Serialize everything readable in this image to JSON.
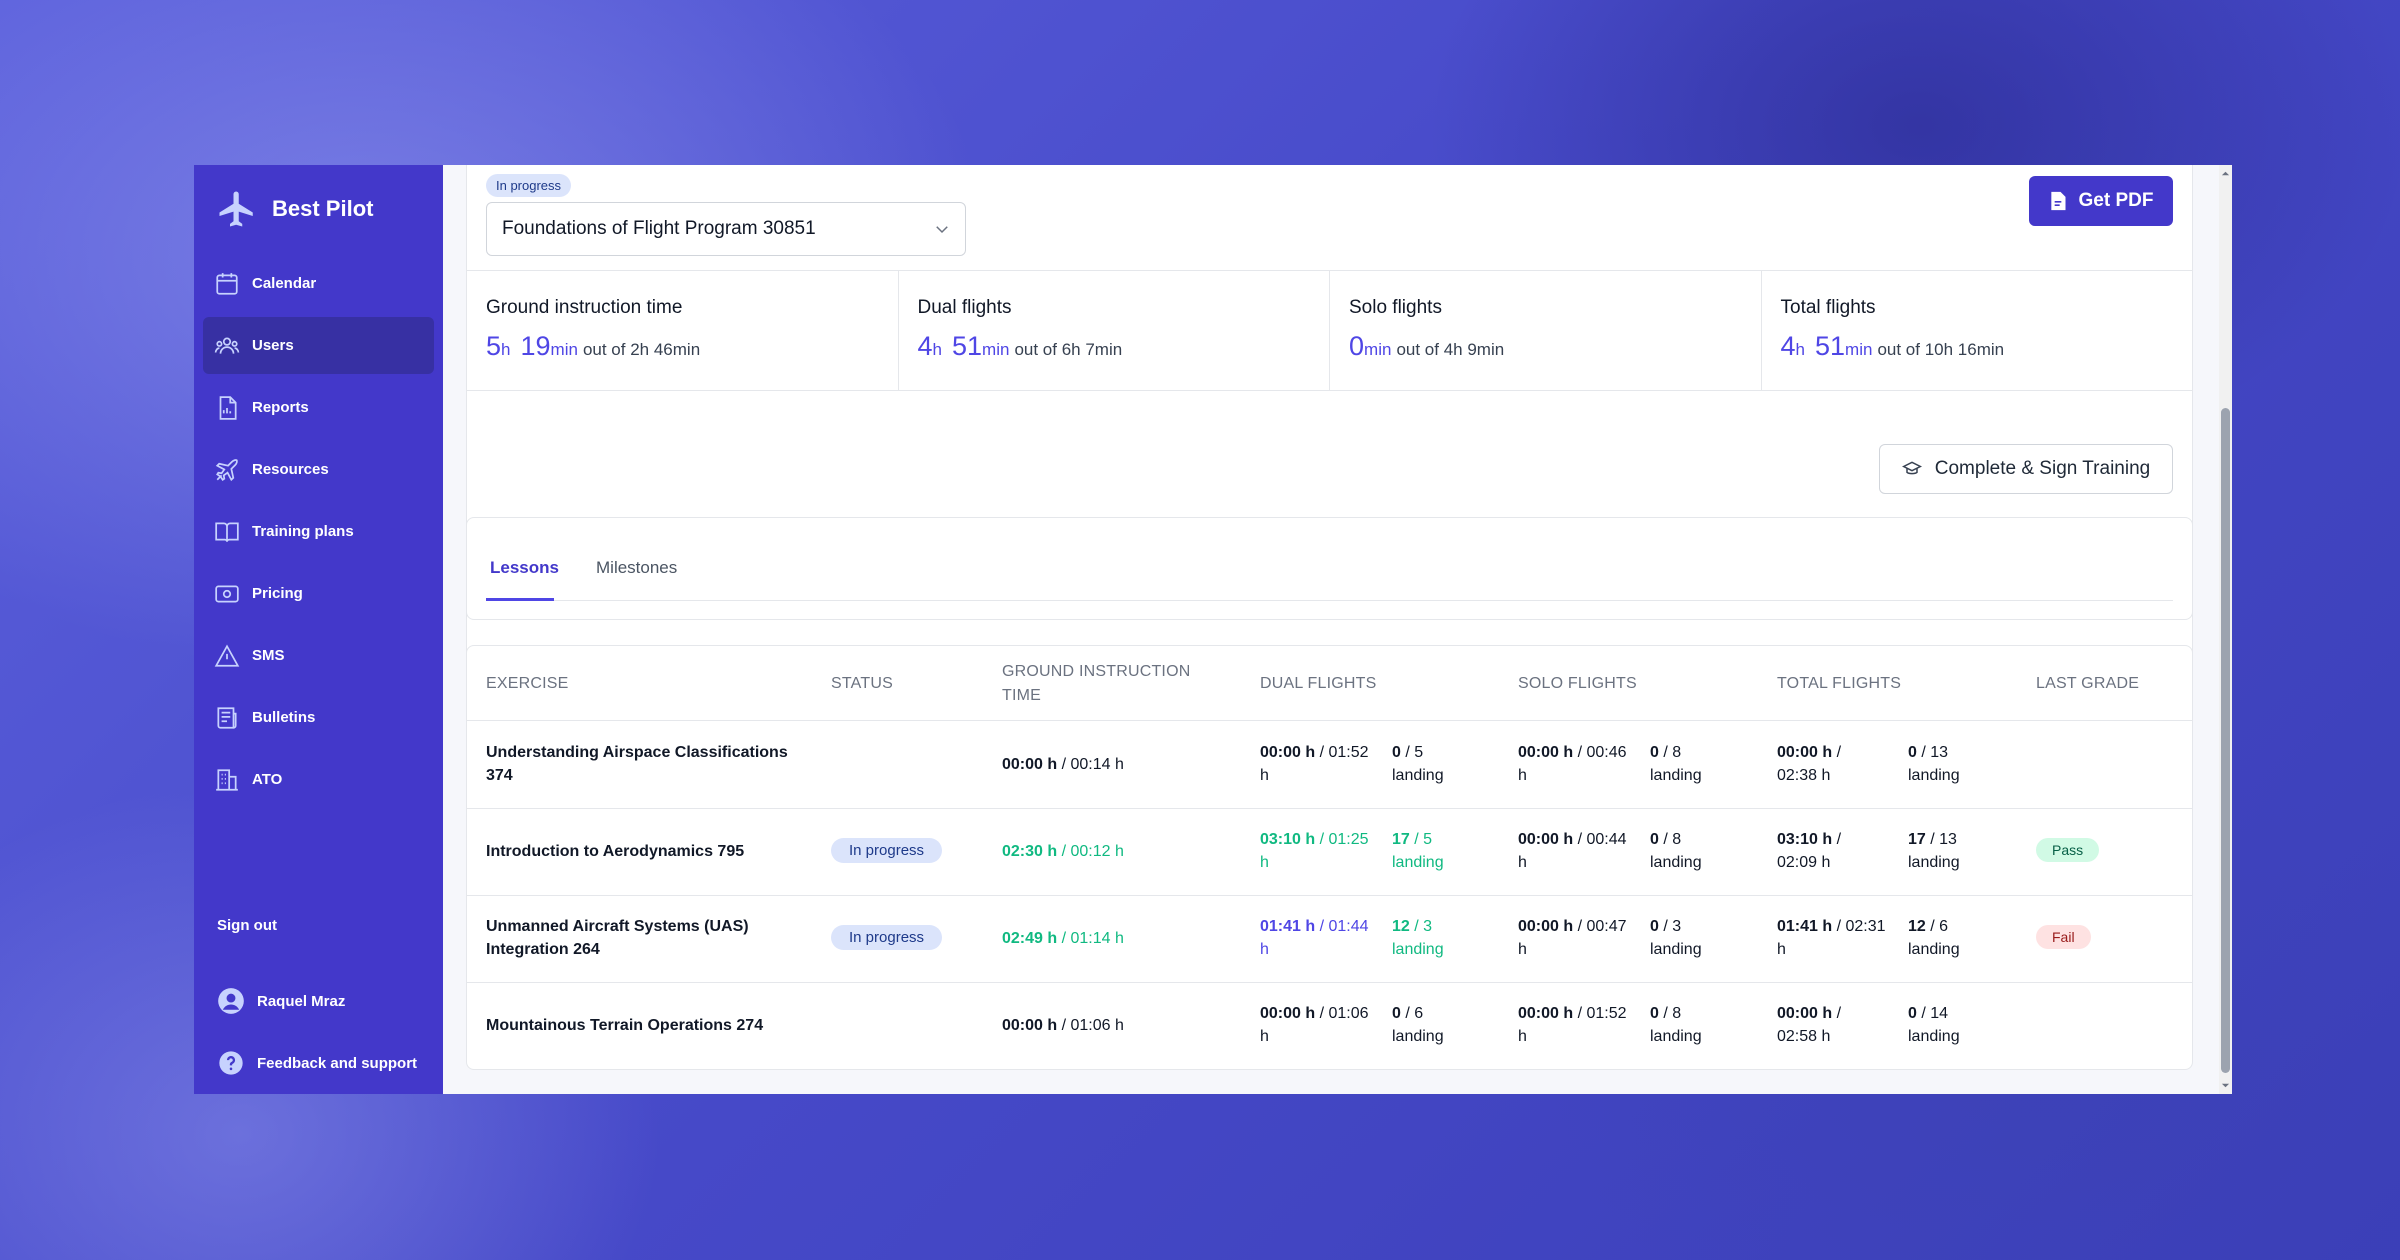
{
  "app": {
    "name": "Best Pilot"
  },
  "sidebar": {
    "items": [
      {
        "label": "Calendar",
        "icon": "calendar-icon"
      },
      {
        "label": "Users",
        "icon": "users-icon",
        "active": true
      },
      {
        "label": "Reports",
        "icon": "report-icon"
      },
      {
        "label": "Resources",
        "icon": "plane-icon"
      },
      {
        "label": "Training plans",
        "icon": "book-icon"
      },
      {
        "label": "Pricing",
        "icon": "money-icon"
      },
      {
        "label": "SMS",
        "icon": "warning-icon"
      },
      {
        "label": "Bulletins",
        "icon": "newspaper-icon"
      },
      {
        "label": "ATO",
        "icon": "building-icon"
      }
    ],
    "sign_out": "Sign out",
    "user": "Raquel Mraz",
    "feedback": "Feedback and support"
  },
  "program": {
    "status": "In progress",
    "selected": "Foundations of Flight Program 30851",
    "pdf_button": "Get PDF",
    "sign_button": "Complete & Sign Training"
  },
  "stats": [
    {
      "label": "Ground instruction time",
      "h": "5",
      "h_unit": "h",
      "m": "19",
      "m_unit": "min",
      "out": "out of 2h 46min"
    },
    {
      "label": "Dual flights",
      "h": "4",
      "h_unit": "h",
      "m": "51",
      "m_unit": "min",
      "out": "out of 6h 7min"
    },
    {
      "label": "Solo flights",
      "h": "",
      "h_unit": "",
      "m": "0",
      "m_unit": "min",
      "out": "out of 4h 9min"
    },
    {
      "label": "Total flights",
      "h": "4",
      "h_unit": "h",
      "m": "51",
      "m_unit": "min",
      "out": "out of 10h 16min"
    }
  ],
  "tabs": {
    "lessons": "Lessons",
    "milestones": "Milestones"
  },
  "table": {
    "headers": {
      "exercise": "EXERCISE",
      "status": "STATUS",
      "ground_1": "GROUND INSTRUCTION",
      "ground_2": "TIME",
      "dual": "DUAL FLIGHTS",
      "solo": "SOLO FLIGHTS",
      "total": "TOTAL FLIGHTS",
      "grade": "LAST GRADE"
    },
    "rows": [
      {
        "ex1": "Understanding Airspace Classifications",
        "ex2": "374",
        "status": "",
        "ground_a": "00:00 h",
        "ground_b": " / 00:14 h",
        "dual_a": "00:00 h",
        "dual_b": " / 01:52",
        "dual_c": "h",
        "dual_l_a": "0",
        "dual_l_b": " / 5",
        "dual_l_c": "landing",
        "solo_a": "00:00 h",
        "solo_b": " / 00:46",
        "solo_c": "h",
        "solo_l_a": "0",
        "solo_l_b": " / 8",
        "solo_l_c": "landing",
        "total_a": "00:00 h",
        "total_b": " /",
        "total_c": "02:38 h",
        "total_l_a": "0",
        "total_l_b": " / 13",
        "total_l_c": "landing",
        "grade": ""
      },
      {
        "ex1": "Introduction to Aerodynamics 795",
        "ex2": "",
        "status": "In progress",
        "ground_a": "02:30 h",
        "ground_b": " / 00:12 h",
        "dual_a": "03:10 h",
        "dual_b": " / 01:25",
        "dual_c": "h",
        "dual_l_a": "17",
        "dual_l_b": " / 5",
        "dual_l_c": "landing",
        "solo_a": "00:00 h",
        "solo_b": " / 00:44",
        "solo_c": "h",
        "solo_l_a": "0",
        "solo_l_b": " / 8",
        "solo_l_c": "landing",
        "total_a": "03:10 h",
        "total_b": " /",
        "total_c": "02:09 h",
        "total_l_a": "17",
        "total_l_b": " / 13",
        "total_l_c": "landing",
        "grade": "Pass"
      },
      {
        "ex1": "Unmanned Aircraft Systems (UAS)",
        "ex2": "Integration 264",
        "status": "In progress",
        "ground_a": "02:49 h",
        "ground_b": " / 01:14 h",
        "dual_a": "01:41 h",
        "dual_b": " / 01:44",
        "dual_c": "h",
        "dual_l_a": "12",
        "dual_l_b": " / 3",
        "dual_l_c": "landing",
        "solo_a": "00:00 h",
        "solo_b": " / 00:47",
        "solo_c": "h",
        "solo_l_a": "0",
        "solo_l_b": " / 3",
        "solo_l_c": "landing",
        "total_a": "01:41 h",
        "total_b": " / 02:31",
        "total_c": "h",
        "total_l_a": "12",
        "total_l_b": " / 6",
        "total_l_c": "landing",
        "grade": "Fail"
      },
      {
        "ex1": "Mountainous Terrain Operations 274",
        "ex2": "",
        "status": "",
        "ground_a": "00:00 h",
        "ground_b": " / 01:06 h",
        "dual_a": "00:00 h",
        "dual_b": " / 01:06",
        "dual_c": "h",
        "dual_l_a": "0",
        "dual_l_b": " / 6",
        "dual_l_c": "landing",
        "solo_a": "00:00 h",
        "solo_b": " / 01:52",
        "solo_c": "h",
        "solo_l_a": "0",
        "solo_l_b": " / 8",
        "solo_l_c": "landing",
        "total_a": "00:00 h",
        "total_b": " /",
        "total_c": "02:58 h",
        "total_l_a": "0",
        "total_l_b": " / 14",
        "total_l_c": "landing",
        "grade": ""
      }
    ]
  },
  "colors": {
    "sidebar": "#4338ca",
    "accent": "#4f46e5",
    "success": "#10b981",
    "badge_bg": "#dbe4fb"
  }
}
